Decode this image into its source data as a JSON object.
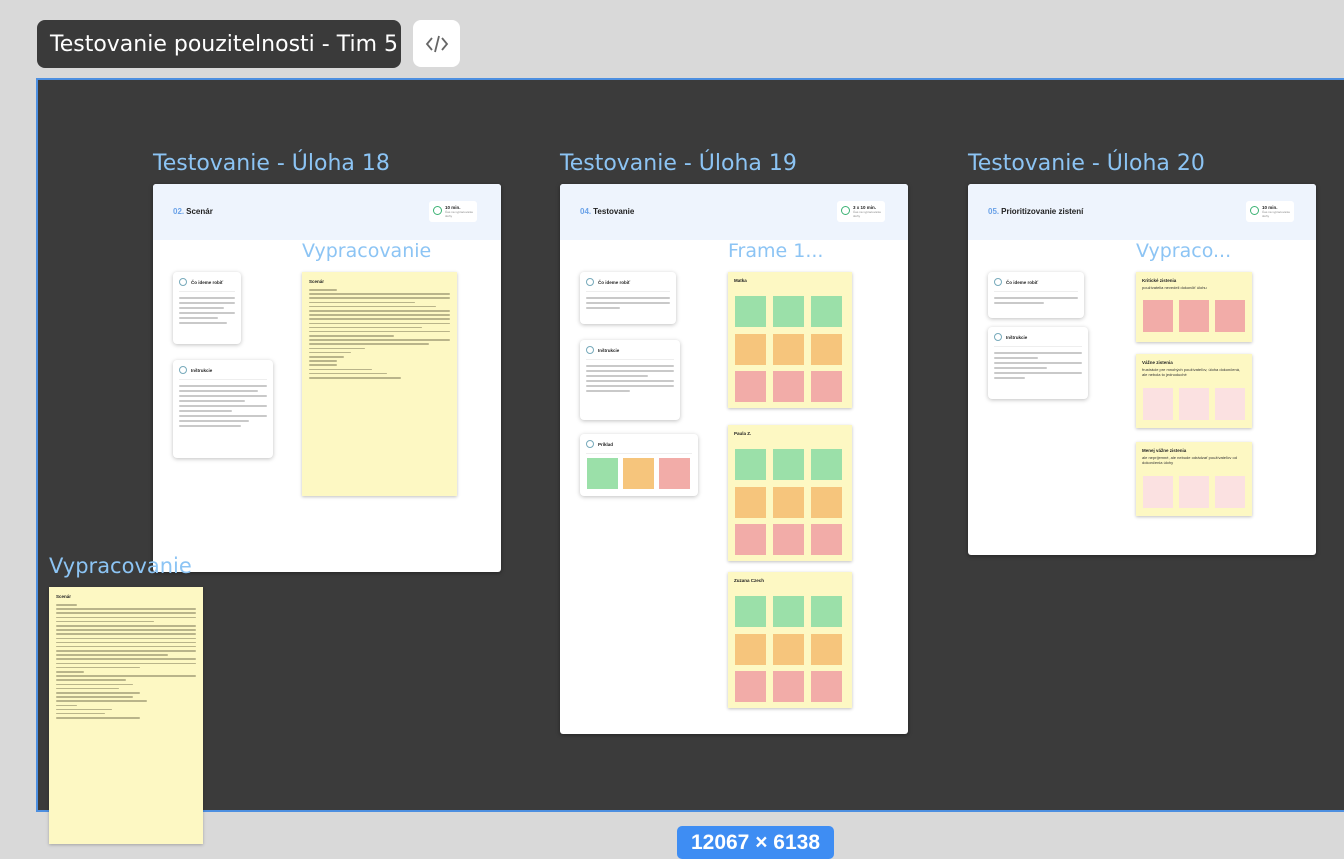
{
  "header": {
    "title": "Testovanie pouzitelnosti - Tim 5",
    "code_icon": "code-icon"
  },
  "canvas": {
    "size_badge": "12067 × 6138"
  },
  "frames": [
    {
      "label": "Testovanie - Úloha 18",
      "number": "02.",
      "title": "Scenár",
      "time": "10 min.",
      "time_sub": "Čas na vypracovanie úlohy",
      "sub_label": "Vypracovanie",
      "doc_title": "Scenár",
      "cards": [
        "Čo ideme robiť",
        "Inštrukcie"
      ]
    },
    {
      "label": "Testovanie - Úloha 19",
      "number": "04.",
      "title": "Testovanie",
      "time": "3 x 10 min.",
      "time_sub": "Čas na vypracovanie úlohy",
      "sub_label": "Frame 1...",
      "cards": [
        "Čo ideme robiť",
        "Inštrukcie",
        "Príklad"
      ],
      "boards": [
        "Matka",
        "Paula Z.",
        "Zuzana Czech"
      ]
    },
    {
      "label": "Testovanie - Úloha 20",
      "number": "05.",
      "title": "Prioritizovanie zistení",
      "time": "10 min.",
      "time_sub": "Čas na vypracovanie úlohy",
      "sub_label": "Vypraco...",
      "cards": [
        "Čo ideme robiť",
        "Inštrukcie"
      ],
      "boards": [
        {
          "title": "Kritické zistenia",
          "sub": "používatelia nevedeli dokončiť úlohu"
        },
        {
          "title": "Vážne zistenia",
          "sub": "frustrácie pre mnohých používateľov, úloha dokončená, ale nebola to jednoduché"
        },
        {
          "title": "Menej vážne zistenia",
          "sub": "ale nepríjemné, ale nebude odrádzať používateľov od dokončenia úlohy"
        }
      ]
    }
  ],
  "left_doc": {
    "label": "Vypracovanie",
    "title": "Scenár"
  }
}
